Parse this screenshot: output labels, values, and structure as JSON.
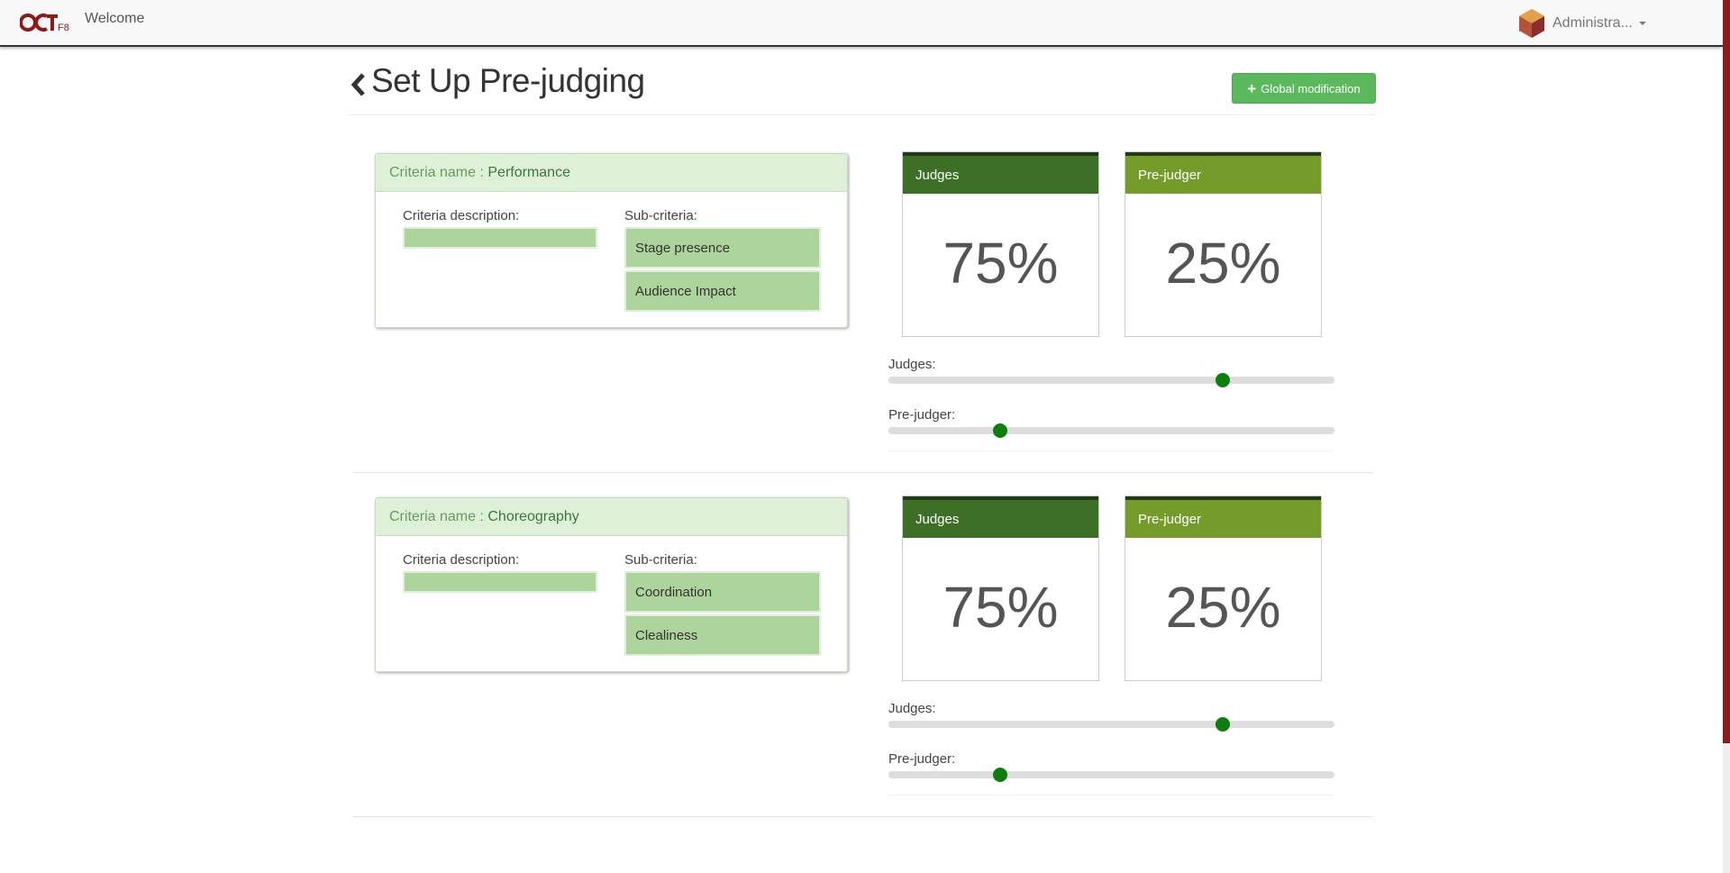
{
  "navbar": {
    "logo_text": "OCT F8",
    "welcome": "Welcome",
    "user_name": "Administra..."
  },
  "page": {
    "title": "Set Up Pre-judging",
    "global_button": "Global modification"
  },
  "criteria_name_label": "Criteria name :",
  "criteria_description_label": "Criteria description:",
  "sub_criteria_label": "Sub-criteria:",
  "criteria": [
    {
      "name": "Performance",
      "sub_criteria": [
        "Stage presence",
        "Audience Impact"
      ],
      "judges": {
        "title": "Judges",
        "value": "75%",
        "slider_label": "Judges:",
        "level": 0.75
      },
      "prejudger": {
        "title": "Pre-judger",
        "value": "25%",
        "slider_label": "Pre-judger:",
        "level": 0.25
      }
    },
    {
      "name": "Choreography",
      "sub_criteria": [
        "Coordination",
        "Clealiness"
      ],
      "judges": {
        "title": "Judges",
        "value": "75%",
        "slider_label": "Judges:",
        "level": 0.75
      },
      "prejudger": {
        "title": "Pre-judger",
        "value": "25%",
        "slider_label": "Pre-judger:",
        "level": 0.25
      }
    }
  ],
  "colors": {
    "primary_green": "#5cb85c",
    "judges_header": "#3e6f27",
    "prejudger_header": "#759b2b",
    "slider_thumb": "#0f7d0f",
    "brand_red": "#8b1a1a"
  },
  "icons": {
    "back": "chevron-left-icon",
    "add": "plus-icon",
    "dropdown": "caret-down-icon"
  }
}
